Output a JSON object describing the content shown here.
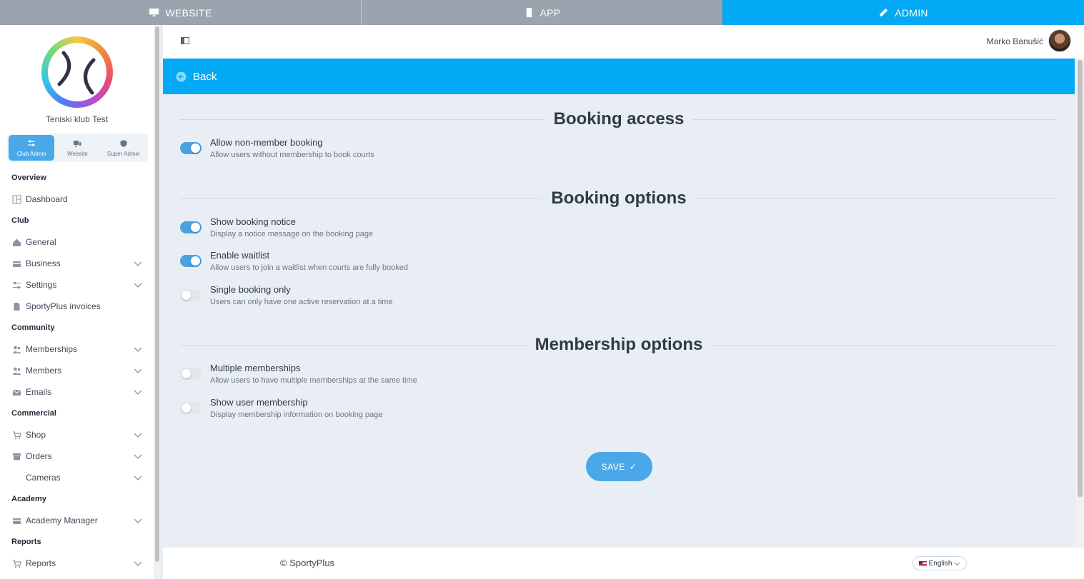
{
  "top_tabs": {
    "website": "WEBSITE",
    "app": "APP",
    "admin": "ADMIN"
  },
  "sidebar": {
    "club_name": "Teniski klub Test",
    "roles": [
      {
        "label": "Club Admin",
        "active": true
      },
      {
        "label": "Website",
        "active": false
      },
      {
        "label": "Super Admin",
        "active": false
      }
    ],
    "sections": {
      "overview": "Overview",
      "club": "Club",
      "community": "Community",
      "commercial": "Commercial",
      "academy": "Academy",
      "reports": "Reports"
    },
    "items": {
      "dashboard": "Dashboard",
      "general": "General",
      "business": "Business",
      "settings": "Settings",
      "invoices": "SportyPlus invoices",
      "memberships": "Memberships",
      "members": "Members",
      "emails": "Emails",
      "shop": "Shop",
      "orders": "Orders",
      "cameras": "Cameras",
      "academy_manager": "Academy Manager",
      "reports": "Reports"
    }
  },
  "header": {
    "user_name": "Marko Banušić"
  },
  "back": {
    "label": "Back"
  },
  "sections": {
    "booking_access": {
      "title": "Booking access",
      "options": [
        {
          "title": "Allow non-member booking",
          "desc": "Allow users without membership to book courts",
          "enabled": true
        }
      ]
    },
    "booking_options": {
      "title": "Booking options",
      "options": [
        {
          "title": "Show booking notice",
          "desc": "Display a notice message on the booking page",
          "enabled": true
        },
        {
          "title": "Enable waitlist",
          "desc": "Allow users to join a waitlist when courts are fully booked",
          "enabled": true
        },
        {
          "title": "Single booking only",
          "desc": "Users can only have one active reservation at a time",
          "enabled": false
        }
      ]
    },
    "membership_options": {
      "title": "Membership options",
      "options": [
        {
          "title": "Multiple memberships",
          "desc": "Allow users to have multiple memberships at the same time",
          "enabled": false
        },
        {
          "title": "Show user membership",
          "desc": "Display membership information on booking page",
          "enabled": false
        }
      ]
    }
  },
  "save": {
    "label": "SAVE",
    "icon": "✓"
  },
  "footer": {
    "copyright": "© SportyPlus",
    "language": "English"
  },
  "colors": {
    "accent": "#03a9f4",
    "toggle_on": "#4aa3df",
    "tab_inactive": "#9aa3ae"
  }
}
